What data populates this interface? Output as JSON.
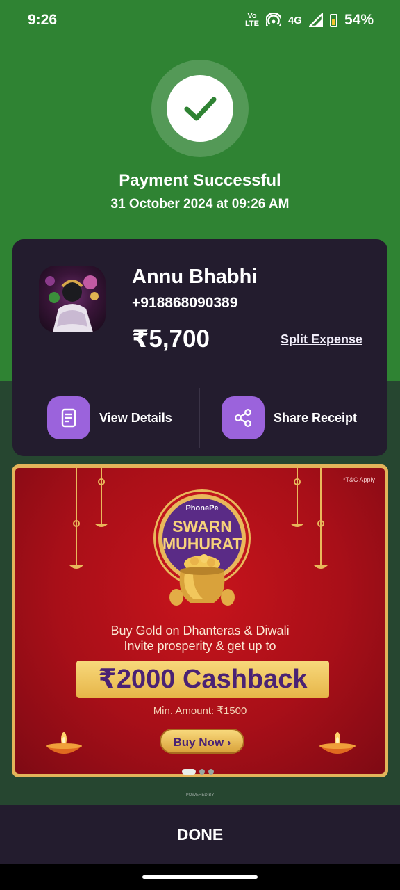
{
  "status_bar": {
    "time": "9:26",
    "volte_line1": "Vo",
    "volte_line2": "LTE",
    "network": "4G",
    "battery": "54%"
  },
  "header": {
    "title": "Payment Successful",
    "date": "31 October 2024 at 09:26 AM"
  },
  "card": {
    "name": "Annu Bhabhi",
    "phone": "+918868090389",
    "amount": "₹5,700",
    "split_label": "Split Expense",
    "view_details_label": "View Details",
    "share_receipt_label": "Share Receipt"
  },
  "banner": {
    "tc": "*T&C Apply",
    "brand": "PhonePe",
    "title_line1": "SWARN",
    "title_line2": "MUHURAT",
    "line1": "Buy Gold on Dhanteras & Diwali",
    "line2": "Invite prosperity & get up to",
    "cashback": "₹2000 Cashback",
    "min_amount": "Min. Amount: ₹1500",
    "button": "Buy Now ›"
  },
  "carousel": {
    "count": 3,
    "active": 0
  },
  "footer": {
    "powered_by": "POWERED BY",
    "done_label": "DONE"
  },
  "colors": {
    "success_green": "#2f8333",
    "card_bg": "#231c2e",
    "accent_purple": "#9b63dc",
    "banner_red": "#c8141c",
    "gold": "#e9b85b"
  }
}
